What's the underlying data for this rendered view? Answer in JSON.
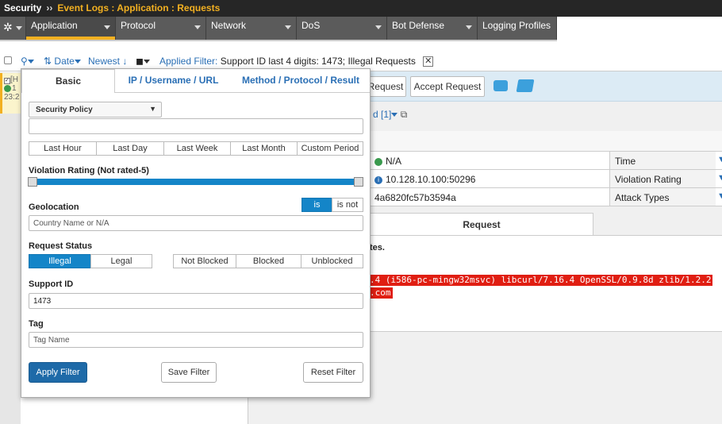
{
  "breadcrumb": {
    "root": "Security",
    "separator": "››",
    "path": "Event Logs : Application : Requests"
  },
  "tabs": [
    {
      "label": "Application",
      "active": true
    },
    {
      "label": "Protocol"
    },
    {
      "label": "Network"
    },
    {
      "label": "DoS"
    },
    {
      "label": "Bot Defense"
    },
    {
      "label": "Logging Profiles"
    }
  ],
  "toolbar": {
    "sort_label": "Date",
    "order_label": "Newest",
    "applied_filter_label": "Applied Filter:",
    "applied_filter_value": "Support ID last 4 digits: 1473; Illegal Requests",
    "clear_icon": "close-icon"
  },
  "left_row": {
    "line1": "[H",
    "line2": "1",
    "line3": "23:2"
  },
  "detail": {
    "action_request_label": "Request",
    "accept_request_label": "Accept Request",
    "link_text": "d [1]",
    "rows": [
      {
        "value": "N/A",
        "key": "Time"
      },
      {
        "value": "10.128.10.100:50296",
        "key": "Violation Rating"
      },
      {
        "value": "4a6820fc57b3594a",
        "key": "Attack Types"
      }
    ],
    "request_tab": "Request",
    "request_text": "tes.",
    "highlight_line1": ".4 (i586-pc-mingw32msvc) libcurl/7.16.4 OpenSSL/0.9.8d zlib/1.2.2",
    "highlight_line2": ".com"
  },
  "filter": {
    "tabs": [
      "Basic",
      "IP / Username / URL",
      "Method / Protocol / Result"
    ],
    "security_policy": "Security Policy",
    "time_buttons": [
      "Last Hour",
      "Last Day",
      "Last Week",
      "Last Month",
      "Custom Period"
    ],
    "violation_rating_label": "Violation Rating (Not rated-5)",
    "geolocation_label": "Geolocation",
    "geo_is": "is",
    "geo_is_not": "is not",
    "country_placeholder": "Country Name or N/A",
    "request_status_label": "Request Status",
    "status_legal_buttons": [
      "Illegal",
      "Legal"
    ],
    "status_block_buttons": [
      "Not Blocked",
      "Blocked",
      "Unblocked"
    ],
    "support_id_label": "Support ID",
    "support_id_value": "1473",
    "tag_label": "Tag",
    "tag_placeholder": "Tag Name",
    "apply_button": "Apply Filter",
    "save_button": "Save Filter",
    "reset_button": "Reset Filter"
  },
  "colors": {
    "accent": "#f2b021",
    "link": "#2a6fb5",
    "primary": "#1e6aa8",
    "highlight": "#e01e12"
  }
}
